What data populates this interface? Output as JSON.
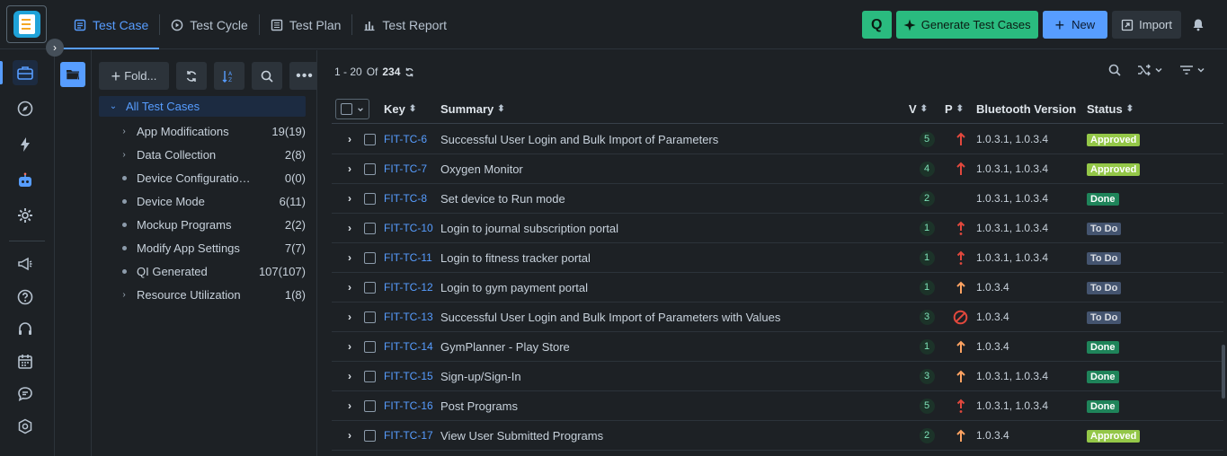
{
  "app": {
    "tabs": [
      {
        "label": "Test Case",
        "icon": "test-case-icon"
      },
      {
        "label": "Test Cycle",
        "icon": "play-circle-icon"
      },
      {
        "label": "Test Plan",
        "icon": "plan-icon"
      },
      {
        "label": "Test Report",
        "icon": "bar-chart-icon"
      }
    ],
    "actions": {
      "ai_label": "Q",
      "generate_label": "Generate Test Cases",
      "new_label": "New",
      "import_label": "Import"
    }
  },
  "tree_tools": {
    "folder_label": "Fold..."
  },
  "tree": {
    "root": "All Test Cases",
    "items": [
      {
        "label": "App Modifications",
        "count": "19(19)",
        "expandable": true
      },
      {
        "label": "Data Collection",
        "count": "2(8)",
        "expandable": true
      },
      {
        "label": "Device Configuration fo...",
        "count": "0(0)",
        "expandable": false
      },
      {
        "label": "Device Mode",
        "count": "6(11)",
        "expandable": false
      },
      {
        "label": "Mockup Programs",
        "count": "2(2)",
        "expandable": false
      },
      {
        "label": "Modify App Settings",
        "count": "7(7)",
        "expandable": false
      },
      {
        "label": "QI Generated",
        "count": "107(107)",
        "expandable": false
      },
      {
        "label": "Resource Utilization",
        "count": "1(8)",
        "expandable": true
      }
    ]
  },
  "pager": {
    "range": "1 - 20",
    "of_label": "Of",
    "total": "234"
  },
  "table": {
    "headers": {
      "key": "Key",
      "summary": "Summary",
      "v": "V",
      "p": "P",
      "bt": "Bluetooth Version",
      "status": "Status"
    },
    "rows": [
      {
        "key": "FIT-TC-6",
        "summary": "Successful User Login and Bulk Import of Parameters",
        "v": "5",
        "p": "high",
        "bt": "1.0.3.1, 1.0.3.4",
        "status": "Approved"
      },
      {
        "key": "FIT-TC-7",
        "summary": "Oxygen Monitor",
        "v": "4",
        "p": "high",
        "bt": "1.0.3.1, 1.0.3.4",
        "status": "Approved"
      },
      {
        "key": "FIT-TC-8",
        "summary": "Set device to Run mode",
        "v": "2",
        "p": "none",
        "bt": "1.0.3.1, 1.0.3.4",
        "status": "Done"
      },
      {
        "key": "FIT-TC-10",
        "summary": "Login to journal subscription portal",
        "v": "1",
        "p": "critical",
        "bt": "1.0.3.1, 1.0.3.4",
        "status": "To Do"
      },
      {
        "key": "FIT-TC-11",
        "summary": "Login to fitness tracker portal",
        "v": "1",
        "p": "critical",
        "bt": "1.0.3.1, 1.0.3.4",
        "status": "To Do"
      },
      {
        "key": "FIT-TC-12",
        "summary": "Login to gym payment portal",
        "v": "1",
        "p": "medium",
        "bt": "1.0.3.4",
        "status": "To Do"
      },
      {
        "key": "FIT-TC-13",
        "summary": "Successful User Login and Bulk Import of Parameters with Values",
        "v": "3",
        "p": "blocker",
        "bt": "1.0.3.4",
        "status": "To Do"
      },
      {
        "key": "FIT-TC-14",
        "summary": "GymPlanner - Play Store",
        "v": "1",
        "p": "medium",
        "bt": "1.0.3.4",
        "status": "Done"
      },
      {
        "key": "FIT-TC-15",
        "summary": "Sign-up/Sign-In",
        "v": "3",
        "p": "medium",
        "bt": "1.0.3.1, 1.0.3.4",
        "status": "Done"
      },
      {
        "key": "FIT-TC-16",
        "summary": "Post Programs",
        "v": "5",
        "p": "critical",
        "bt": "1.0.3.1, 1.0.3.4",
        "status": "Done"
      },
      {
        "key": "FIT-TC-17",
        "summary": "View User Submitted Programs",
        "v": "2",
        "p": "medium",
        "bt": "1.0.3.4",
        "status": "Approved"
      }
    ]
  },
  "colors": {
    "accent": "#579dff",
    "green": "#2abb7f",
    "priority_red": "#e2483d",
    "priority_orange": "#fea362"
  }
}
